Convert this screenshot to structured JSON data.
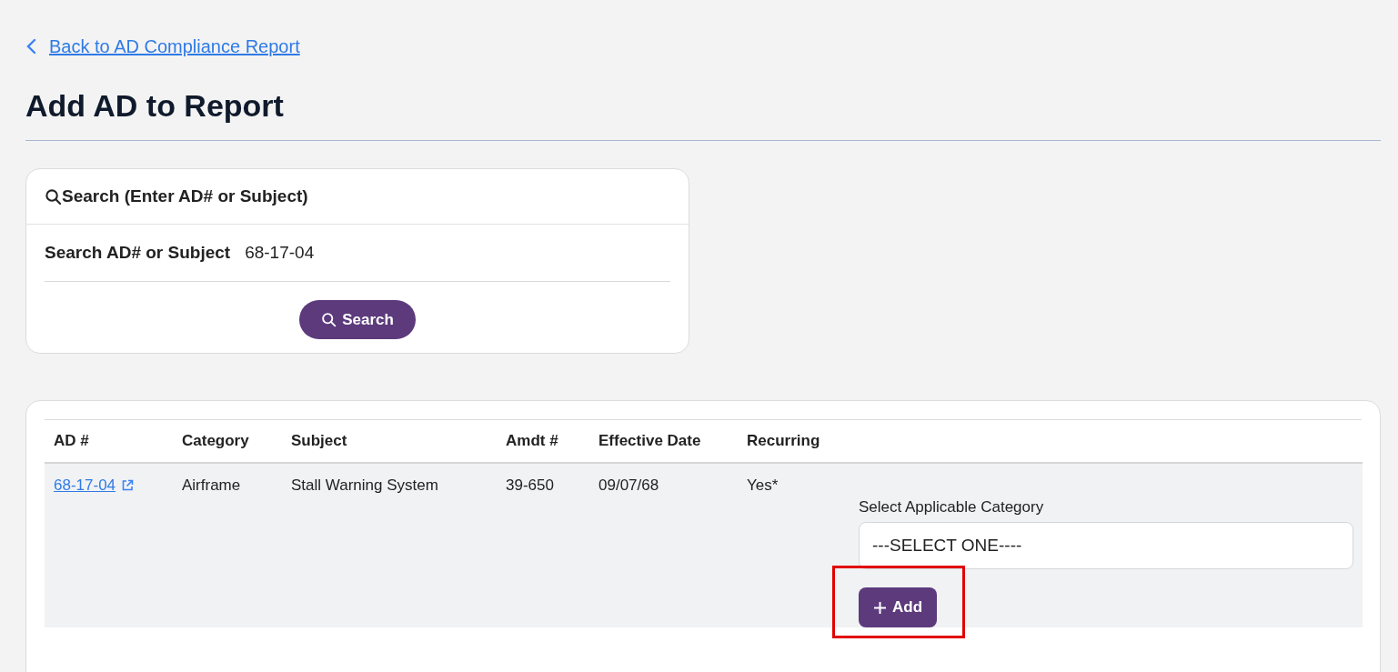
{
  "back_link": {
    "label": "Back to AD Compliance Report"
  },
  "title": "Add AD to Report",
  "search_card": {
    "title": "Search (Enter AD# or Subject)",
    "field_label": "Search AD# or Subject",
    "field_value": "68-17-04",
    "button": "Search"
  },
  "table": {
    "columns": [
      "AD #",
      "Category",
      "Subject",
      "Amdt #",
      "Effective Date",
      "Recurring"
    ],
    "rows": [
      {
        "ad": "68-17-04",
        "category": "Airframe",
        "subject": "Stall Warning System",
        "amdt": "39-650",
        "effective_date": "09/07/68",
        "recurring": "Yes*",
        "category_select": {
          "label": "Select Applicable Category",
          "value": "---SELECT ONE----"
        },
        "add_button": "Add",
        "highlighted": true
      }
    ]
  }
}
